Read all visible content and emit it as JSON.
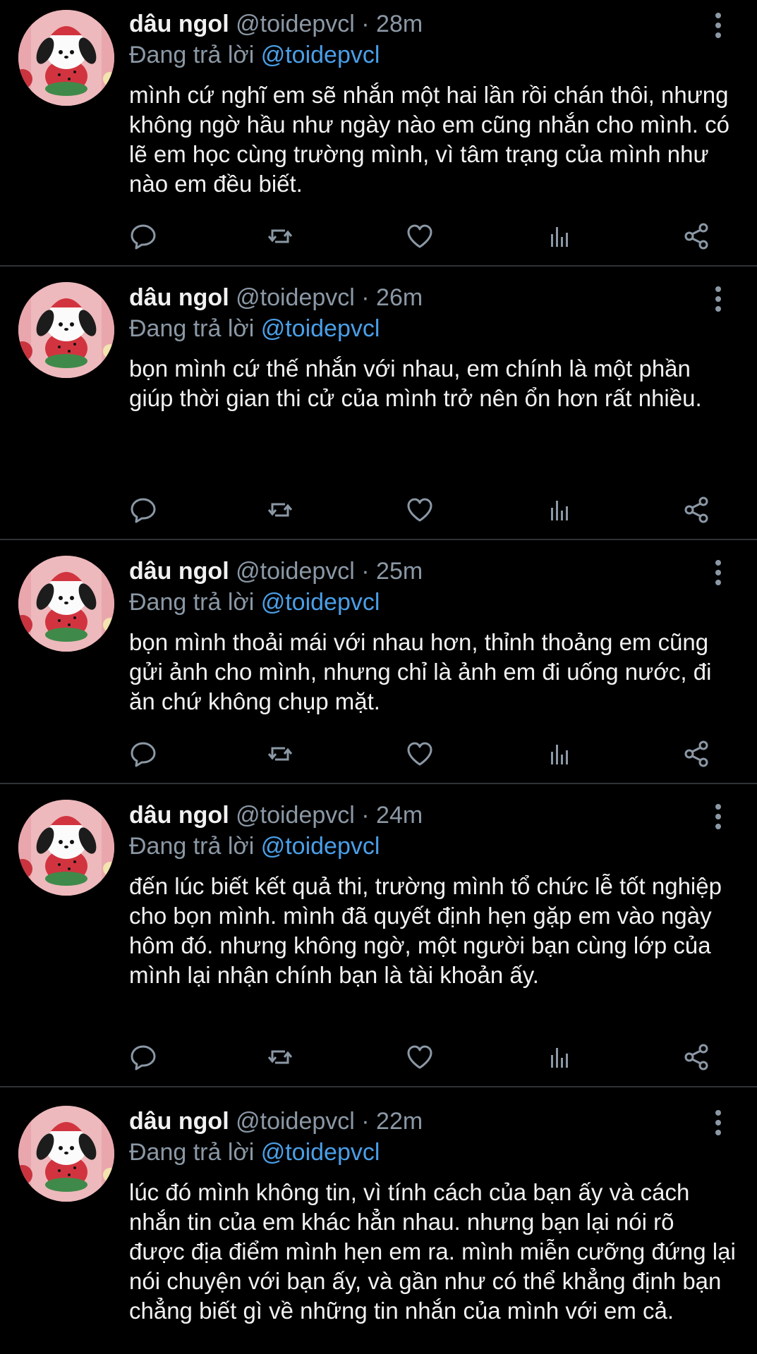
{
  "colors": {
    "background": "#000000",
    "text": "#f1f1f1",
    "secondary": "#8b98a5",
    "accent": "#4a9fe8",
    "divider": "#2f3336"
  },
  "icons": {
    "more": "more-vertical-icon",
    "reply": "reply-icon",
    "retweet": "retweet-icon",
    "like": "like-icon",
    "views": "views-icon",
    "share": "share-icon"
  },
  "tweets": [
    {
      "name": "dâu ngol",
      "handle": "@toidepvcl",
      "time": "· 28m",
      "reply_prefix": "Đang trả lời",
      "reply_to": "@toidepvcl",
      "text": "mình cứ nghĩ em sẽ nhắn một hai lần rồi chán thôi, nhưng không ngờ hầu như ngày nào em cũng nhắn cho mình. có lẽ em học cùng trường mình, vì tâm trạng của mình như nào em đều biết."
    },
    {
      "name": "dâu ngol",
      "handle": "@toidepvcl",
      "time": "· 26m",
      "reply_prefix": "Đang trả lời",
      "reply_to": "@toidepvcl",
      "text": "bọn mình cứ thế nhắn với nhau, em chính là một phần giúp thời gian thi cử của mình trở nên ổn hơn rất nhiều."
    },
    {
      "name": "dâu ngol",
      "handle": "@toidepvcl",
      "time": "· 25m",
      "reply_prefix": "Đang trả lời",
      "reply_to": "@toidepvcl",
      "text": "bọn mình thoải mái với nhau hơn, thỉnh thoảng em cũng gửi ảnh cho mình, nhưng chỉ là ảnh em đi uống nước, đi ăn chứ không chụp mặt."
    },
    {
      "name": "dâu ngol",
      "handle": "@toidepvcl",
      "time": "· 24m",
      "reply_prefix": "Đang trả lời",
      "reply_to": "@toidepvcl",
      "text": "đến lúc biết kết quả thi, trường mình tổ chức lễ tốt nghiệp cho bọn mình. mình đã quyết định hẹn gặp em vào ngày hôm đó. nhưng không ngờ, một người bạn cùng lớp của mình lại nhận chính bạn là tài khoản ấy."
    },
    {
      "name": "dâu ngol",
      "handle": "@toidepvcl",
      "time": "· 22m",
      "reply_prefix": "Đang trả lời",
      "reply_to": "@toidepvcl",
      "text": "lúc đó mình không tin, vì tính cách của bạn ấy và cách nhắn tin của em khác hẳn nhau. nhưng bạn lại nói rõ được địa điểm mình hẹn em ra. mình miễn cưỡng đứng lại nói chuyện với bạn ấy, và gần như có thể khẳng định bạn chẳng biết gì về những tin nhắn của mình với em cả."
    }
  ]
}
